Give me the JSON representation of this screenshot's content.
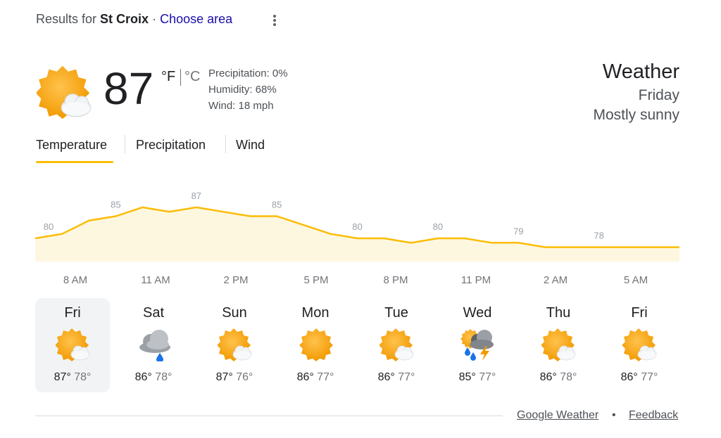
{
  "header": {
    "results_prefix": "Results for",
    "place": "St Croix",
    "separator": "·",
    "choose_area": "Choose area"
  },
  "current": {
    "temp": "87",
    "unit_f": "°F",
    "unit_c": "°C",
    "precipitation": "Precipitation: 0%",
    "humidity": "Humidity: 68%",
    "wind": "Wind: 18 mph",
    "icon": "partly-sunny-icon"
  },
  "summary": {
    "title": "Weather",
    "day": "Friday",
    "condition": "Mostly sunny"
  },
  "tabs": [
    {
      "label": "Temperature",
      "selected": true
    },
    {
      "label": "Precipitation",
      "selected": false
    },
    {
      "label": "Wind",
      "selected": false
    }
  ],
  "chart_data": {
    "type": "area",
    "x": [
      "8 AM",
      "9 AM",
      "10 AM",
      "11 AM",
      "12 PM",
      "1 PM",
      "2 PM",
      "3 PM",
      "4 PM",
      "5 PM",
      "6 PM",
      "7 PM",
      "8 PM",
      "9 PM",
      "10 PM",
      "11 PM",
      "12 AM",
      "1 AM",
      "2 AM",
      "3 AM",
      "4 AM",
      "5 AM",
      "6 AM",
      "7 AM",
      "8 AM"
    ],
    "values": [
      80,
      81,
      84,
      85,
      87,
      86,
      87,
      86,
      85,
      85,
      83,
      81,
      80,
      80,
      79,
      80,
      80,
      79,
      79,
      78,
      78,
      78,
      78,
      78,
      78
    ],
    "labels": [
      {
        "index": 0,
        "text": "80"
      },
      {
        "index": 3,
        "text": "85"
      },
      {
        "index": 6,
        "text": "87"
      },
      {
        "index": 9,
        "text": "85"
      },
      {
        "index": 12,
        "text": "80"
      },
      {
        "index": 15,
        "text": "80"
      },
      {
        "index": 18,
        "text": "79"
      },
      {
        "index": 21,
        "text": "78"
      }
    ],
    "tick_labels": [
      "8 AM",
      "11 AM",
      "2 PM",
      "5 PM",
      "8 PM",
      "11 PM",
      "2 AM",
      "5 AM"
    ],
    "ylim": [
      70,
      90
    ],
    "line_color": "#fbbc04",
    "fill_color": "#fef7e0"
  },
  "forecast": [
    {
      "day": "Fri",
      "hi": "87°",
      "lo": "78°",
      "icon": "partly-sunny-icon",
      "selected": true
    },
    {
      "day": "Sat",
      "hi": "86°",
      "lo": "78°",
      "icon": "rain-cloud-icon",
      "selected": false
    },
    {
      "day": "Sun",
      "hi": "87°",
      "lo": "76°",
      "icon": "partly-sunny-icon",
      "selected": false
    },
    {
      "day": "Mon",
      "hi": "86°",
      "lo": "77°",
      "icon": "sunny-icon",
      "selected": false
    },
    {
      "day": "Tue",
      "hi": "86°",
      "lo": "77°",
      "icon": "partly-sunny-icon",
      "selected": false
    },
    {
      "day": "Wed",
      "hi": "85°",
      "lo": "77°",
      "icon": "thunderstorm-icon",
      "selected": false
    },
    {
      "day": "Thu",
      "hi": "86°",
      "lo": "78°",
      "icon": "partly-sunny-icon",
      "selected": false
    },
    {
      "day": "Fri",
      "hi": "86°",
      "lo": "77°",
      "icon": "partly-sunny-icon",
      "selected": false
    }
  ],
  "footer": {
    "google_weather": "Google Weather",
    "dot": "•",
    "feedback": "Feedback"
  }
}
